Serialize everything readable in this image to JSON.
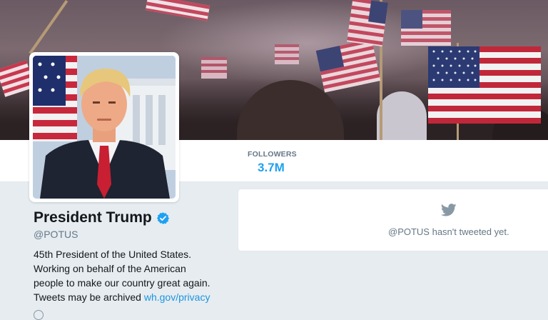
{
  "profile": {
    "name": "President Trump",
    "handle": "@POTUS",
    "verified": true,
    "bio_lines": [
      "45th President of the United States.",
      "Working on behalf of the American",
      "people to make our country great again.",
      "Tweets may be archived "
    ],
    "bio_link": "wh.gov/privacy"
  },
  "stats": {
    "followers_label": "FOLLOWERS",
    "followers_value": "3.7M"
  },
  "timeline": {
    "empty_message": "@POTUS hasn't tweeted yet."
  },
  "colors": {
    "accent": "#1da1f2",
    "link": "#1b95e0",
    "muted": "#657786",
    "background": "#e6ecf0"
  },
  "icons": {
    "verified": "verified-badge-icon",
    "bird": "twitter-bird-icon"
  }
}
